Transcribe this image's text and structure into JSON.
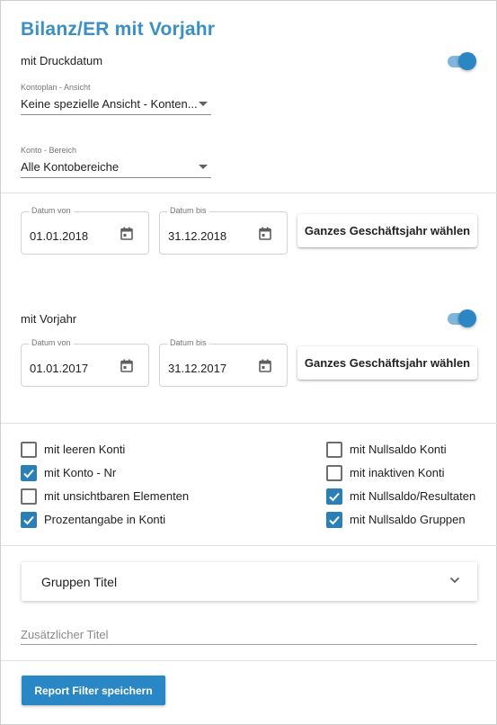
{
  "header": {
    "title": "Bilanz/ER mit Vorjahr"
  },
  "print_date": {
    "label": "mit Druckdatum",
    "enabled": true
  },
  "chart_of_accounts": {
    "label": "Kontoplan - Ansicht",
    "value": "Keine spezielle Ansicht - Konten..."
  },
  "account_range": {
    "label": "Konto - Bereich",
    "value": "Alle Kontobereiche"
  },
  "current_period": {
    "from_label": "Datum von",
    "from_value": "01.01.2018",
    "to_label": "Datum bis",
    "to_value": "31.12.2018",
    "fiscal_year_button": "Ganzes Geschäftsjahr wählen"
  },
  "previous_year": {
    "label": "mit Vorjahr",
    "enabled": true,
    "from_label": "Datum von",
    "from_value": "01.01.2017",
    "to_label": "Datum bis",
    "to_value": "31.12.2017",
    "fiscal_year_button": "Ganzes Geschäftsjahr wählen"
  },
  "options": {
    "left": [
      {
        "label": "mit leeren Konti",
        "checked": false
      },
      {
        "label": "mit Konto - Nr",
        "checked": true
      },
      {
        "label": "mit unsichtbaren Elementen",
        "checked": false
      },
      {
        "label": "Prozentangabe in Konti",
        "checked": true
      }
    ],
    "right": [
      {
        "label": "mit Nullsaldo Konti",
        "checked": false
      },
      {
        "label": "mit inaktiven Konti",
        "checked": false
      },
      {
        "label": "mit Nullsaldo/Resultaten",
        "checked": true
      },
      {
        "label": "mit Nullsaldo Gruppen",
        "checked": true
      }
    ]
  },
  "group_titles": {
    "label": "Gruppen Titel"
  },
  "additional_title": {
    "placeholder": "Zusätzlicher Titel",
    "value": ""
  },
  "footer": {
    "save_button": "Report Filter speichern"
  },
  "colors": {
    "accent": "#2a87c6",
    "title": "#3a8fc7",
    "toggle_thumb": "#2d86c4",
    "toggle_track": "#7fb6dc"
  }
}
